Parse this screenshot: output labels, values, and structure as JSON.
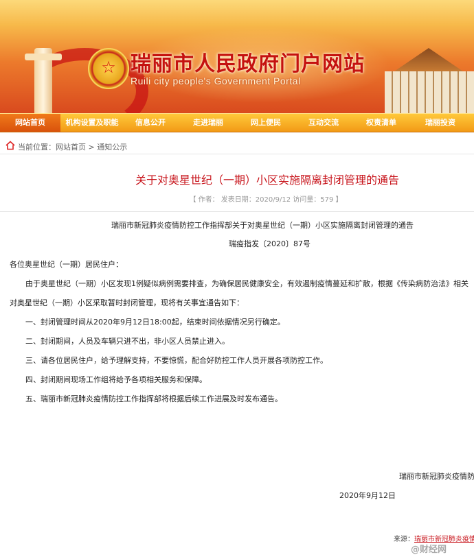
{
  "site": {
    "title": "瑞丽市人民政府门户网站",
    "subtitle": "Ruili city people's Government Portal",
    "emblem_glyph": "☆"
  },
  "nav": {
    "items": [
      {
        "label": "网站首页",
        "active": true
      },
      {
        "label": "机构设置及职能"
      },
      {
        "label": "信息公开"
      },
      {
        "label": "走进瑞丽"
      },
      {
        "label": "网上便民"
      },
      {
        "label": "互动交流"
      },
      {
        "label": "权责清单"
      },
      {
        "label": "瑞丽投资"
      }
    ]
  },
  "breadcrumb": {
    "prefix": "当前位置：",
    "home": "网站首页",
    "sep": " > ",
    "current": "通知公示"
  },
  "article": {
    "title": "关于对奥星世纪（一期）小区实施隔离封闭管理的通告",
    "meta": "【 作者：   发表日期：2020/9/12 访问量：579 】",
    "doc_title": "瑞丽市新冠肺炎疫情防控工作指挥部关于对奥星世纪（一期）小区实施隔离封闭管理的通告",
    "doc_number": "瑞疫指发〔2020〕87号",
    "salutation": "各位奥星世纪（一期）居民住户：",
    "para1_line1": "由于奥星世纪（一期）小区发现1例疑似病例需要排查，为确保居民健康安全，有效遏制疫情蔓延和扩散，根据《传染病防治法》相关",
    "para1_line2": "对奥星世纪（一期）小区采取暂时封闭管理，现将有关事宜通告如下：",
    "items": [
      "一、封闭管理时间从2020年9月12日18:00起，结束时间依据情况另行确定。",
      "二、封闭期间，人员及车辆只进不出，非小区人员禁止进入。",
      "三、请各位居民住户，给予理解支持，不要惊慌，配合好防控工作人员开展各项防控工作。",
      "四、封闭期间现场工作组将给予各项相关服务和保障。",
      "五、瑞丽市新冠肺炎疫情防控工作指挥部将根据后续工作进展及时发布通告。"
    ],
    "signature": "瑞丽市新冠肺炎疫情防",
    "date": "2020年9月12日",
    "source_label": "来源：",
    "source_value": "瑞丽市新冠肺炎疫情"
  },
  "watermark": "@财经网"
}
